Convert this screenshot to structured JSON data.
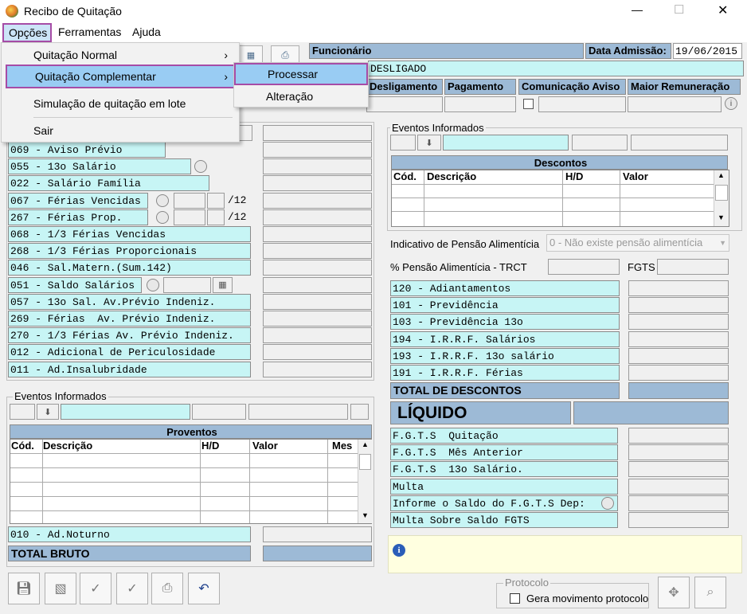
{
  "window": {
    "title": "Recibo de Quitação",
    "min": "—",
    "max": "☐",
    "close": "✕"
  },
  "menubar": {
    "opcoes": "Opções",
    "ferramentas": "Ferramentas",
    "ajuda": "Ajuda"
  },
  "menu": {
    "items": [
      "Quitação Normal",
      "Quitação Complementar",
      "Simulação de quitação em lote",
      "Sair"
    ],
    "arrow": "›",
    "sub": [
      "Processar",
      "Alteração"
    ]
  },
  "top": {
    "funcionario": "Funcionário",
    "data_admissao_label": "Data Admissão:",
    "data_admissao": "19/06/2015",
    "situacao": "DESLIGADO",
    "desligamento": "Desligamento",
    "pagamento": "Pagamento",
    "comunicacao": "Comunicação Aviso",
    "maior_rem": "Maior Remuneração"
  },
  "left_rows": [
    "069 - Aviso Prévio",
    "055 - 13o Salário",
    "022 - Salário Família",
    "067 - Férias Vencidas",
    "267 - Férias Prop.",
    "068 - 1/3 Férias Vencidas",
    "268 - 1/3 Férias Proporcionais",
    "046 - Sal.Matern.(Sum.142)",
    "051 - Saldo Salários",
    "057 - 13o Sal. Av.Prévio Indeniz.",
    "269 - Férias  Av. Prévio Indeniz.",
    "270 - 1/3 Férias Av. Prévio Indeniz.",
    "012 - Adicional de Periculosidade",
    "011 - Ad.Insalubridade"
  ],
  "slash12": "/12",
  "eventos_label": "Eventos Informados",
  "proventos": {
    "title": "Proventos",
    "cols": [
      "Cód.",
      "Descrição",
      "H/D",
      "Valor",
      "Mes"
    ]
  },
  "noturno": "010 - Ad.Noturno",
  "total_bruto": "TOTAL BRUTO",
  "descontos": {
    "title": "Descontos",
    "cols": [
      "Cód.",
      "Descrição",
      "H/D",
      "Valor"
    ]
  },
  "pensao_label": "Indicativo de Pensão Alimentícia",
  "pensao_value": "0 - Não existe pensão alimentícia",
  "pct_pensao": "% Pensão Alimentícia - TRCT",
  "fgts": "FGTS",
  "right_rows": [
    "120 - Adiantamentos",
    "101 - Previdência",
    "103 - Previdência 13o",
    "194 - I.R.R.F. Salários",
    "193 - I.R.R.F. 13o salário",
    "191 - I.R.R.F. Férias"
  ],
  "total_descontos": "TOTAL DE DESCONTOS",
  "liquido": "LÍQUIDO",
  "fgts_rows": [
    "F.G.T.S  Quitação",
    "F.G.T.S  Mês Anterior",
    "F.G.T.S  13o Salário.",
    "Multa",
    "Informe o Saldo do F.G.T.S Dep:",
    "Multa Sobre Saldo FGTS"
  ],
  "protocolo": {
    "title": "Protocolo",
    "check": "Gera movimento protocolo"
  },
  "colors": {
    "cyan": "#c7f5f5",
    "blue": "#9dbad6",
    "highlight": "#a64ca6",
    "menu_hl": "#99ccf3"
  }
}
